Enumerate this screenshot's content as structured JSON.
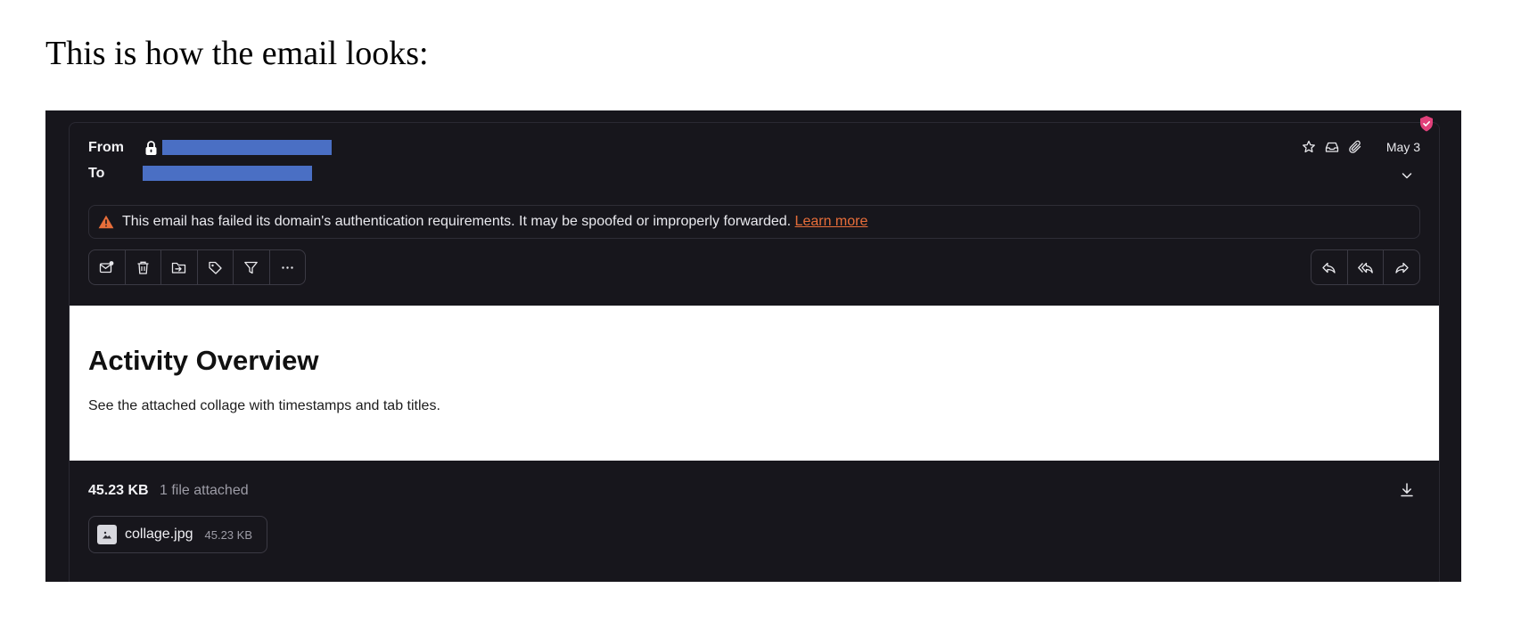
{
  "intro_text": "This is how the email looks:",
  "header": {
    "from_label": "From",
    "to_label": "To",
    "date": "May 3",
    "meta_icons": [
      "star-icon",
      "inbox-icon",
      "paperclip-icon"
    ]
  },
  "warning": {
    "message": "This email has failed its domain's authentication requirements. It may be spoofed or improperly forwarded.",
    "link": "Learn more"
  },
  "toolbar": {
    "left_actions": [
      "mark-unread-icon",
      "trash-icon",
      "move-to-folder-icon",
      "label-icon",
      "filter-icon",
      "more-icon"
    ],
    "right_actions": [
      "reply-icon",
      "reply-all-icon",
      "forward-icon"
    ]
  },
  "body": {
    "heading": "Activity Overview",
    "text": "See the attached collage with timestamps and tab titles."
  },
  "attachments": {
    "total_size": "45.23 KB",
    "count_label": "1 file attached",
    "files": [
      {
        "name": "collage.jpg",
        "size": "45.23 KB"
      }
    ]
  },
  "colors": {
    "background_dark": "#17161c",
    "warning_orange": "#e86e3a",
    "shield_pink": "#e0407a",
    "redaction_blue": "#4a6fc4"
  }
}
